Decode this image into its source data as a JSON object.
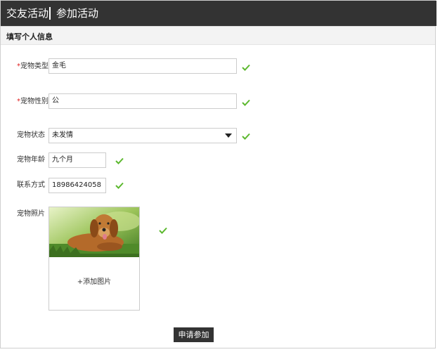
{
  "header": {
    "title": "交友活动",
    "subtitle": "参加活动"
  },
  "section": {
    "title": "填写个人信息"
  },
  "form": {
    "pet_type": {
      "required_mark": "*",
      "label": "宠物类型",
      "value": "金毛"
    },
    "pet_gender": {
      "required_mark": "*",
      "label": "宠物性别",
      "value": "公"
    },
    "pet_status": {
      "label": "宠物状态",
      "value": "未发情"
    },
    "pet_age": {
      "label": "宠物年龄",
      "value": "九个月"
    },
    "contact": {
      "label": "联系方式",
      "value": "18986424058"
    },
    "pet_photo": {
      "label": "宠物照片",
      "add_label": "+添加图片"
    }
  },
  "submit_label": "申请参加",
  "colors": {
    "header_bg": "#333333",
    "check": "#5cb82e",
    "required": "#e02020"
  },
  "icons": {
    "valid": "check-icon",
    "dropdown": "chevron-down-icon"
  }
}
